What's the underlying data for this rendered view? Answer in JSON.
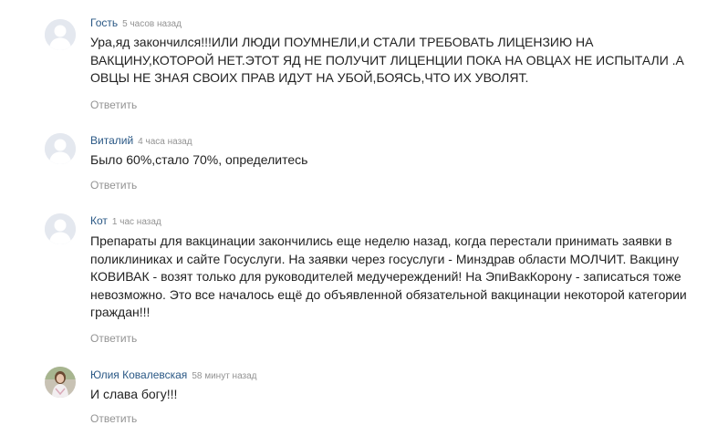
{
  "comments": [
    {
      "author": "Гость",
      "time": "5 часов назад",
      "lines": [
        "Ура,яд закончился!!!ИЛИ ЛЮДИ ПОУМНЕЛИ,И СТАЛИ ТРЕБОВАТЬ ЛИЦЕНЗИЮ НА",
        "ВАКЦИНУ,КОТОРОЙ НЕТ.ЭТОТ ЯД НЕ ПОЛУЧИТ ЛИЦЕНЦИИ ПОКА НА ОВЦАХ НЕ ИСПЫТАЛИ .А",
        "ОВЦЫ НЕ ЗНАЯ СВОИХ ПРАВ ИДУТ НА УБОЙ,БОЯСЬ,ЧТО ИХ УВОЛЯТ."
      ],
      "reply": "Ответить",
      "avatar": "default-avatar-icon"
    },
    {
      "author": "Виталий",
      "time": "4 часа назад",
      "lines": [
        "Было 60%,стало 70%, определитесь"
      ],
      "reply": "Ответить",
      "avatar": "default-avatar-icon"
    },
    {
      "author": "Кот",
      "time": "1 час назад",
      "lines": [
        "Препараты для вакцинации закончились еще неделю назад, когда перестали принимать заявки в",
        "поликлиниках и сайте Госуслуги. На заявки через госуслуги - Минздрав области МОЛЧИТ. Вакцину",
        "КОВИВАК - возят только для руководителей медучереждений! На ЭпиВакКорону - записаться тоже",
        "невозможно. Это все началось ещё до объявленной обязательной вакцинации некоторой категории",
        "граждан!!!"
      ],
      "reply": "Ответить",
      "avatar": "default-avatar-icon"
    },
    {
      "author": "Юлия Ковалевская",
      "time": "58 минут назад",
      "lines": [
        "И слава богу!!!"
      ],
      "reply": "Ответить",
      "avatar": "photo-avatar"
    }
  ],
  "colors": {
    "author": "#2a5885",
    "meta": "#939393",
    "text": "#222222",
    "avatar_bg": "#e4e8ef",
    "avatar_fg": "#ffffff"
  }
}
